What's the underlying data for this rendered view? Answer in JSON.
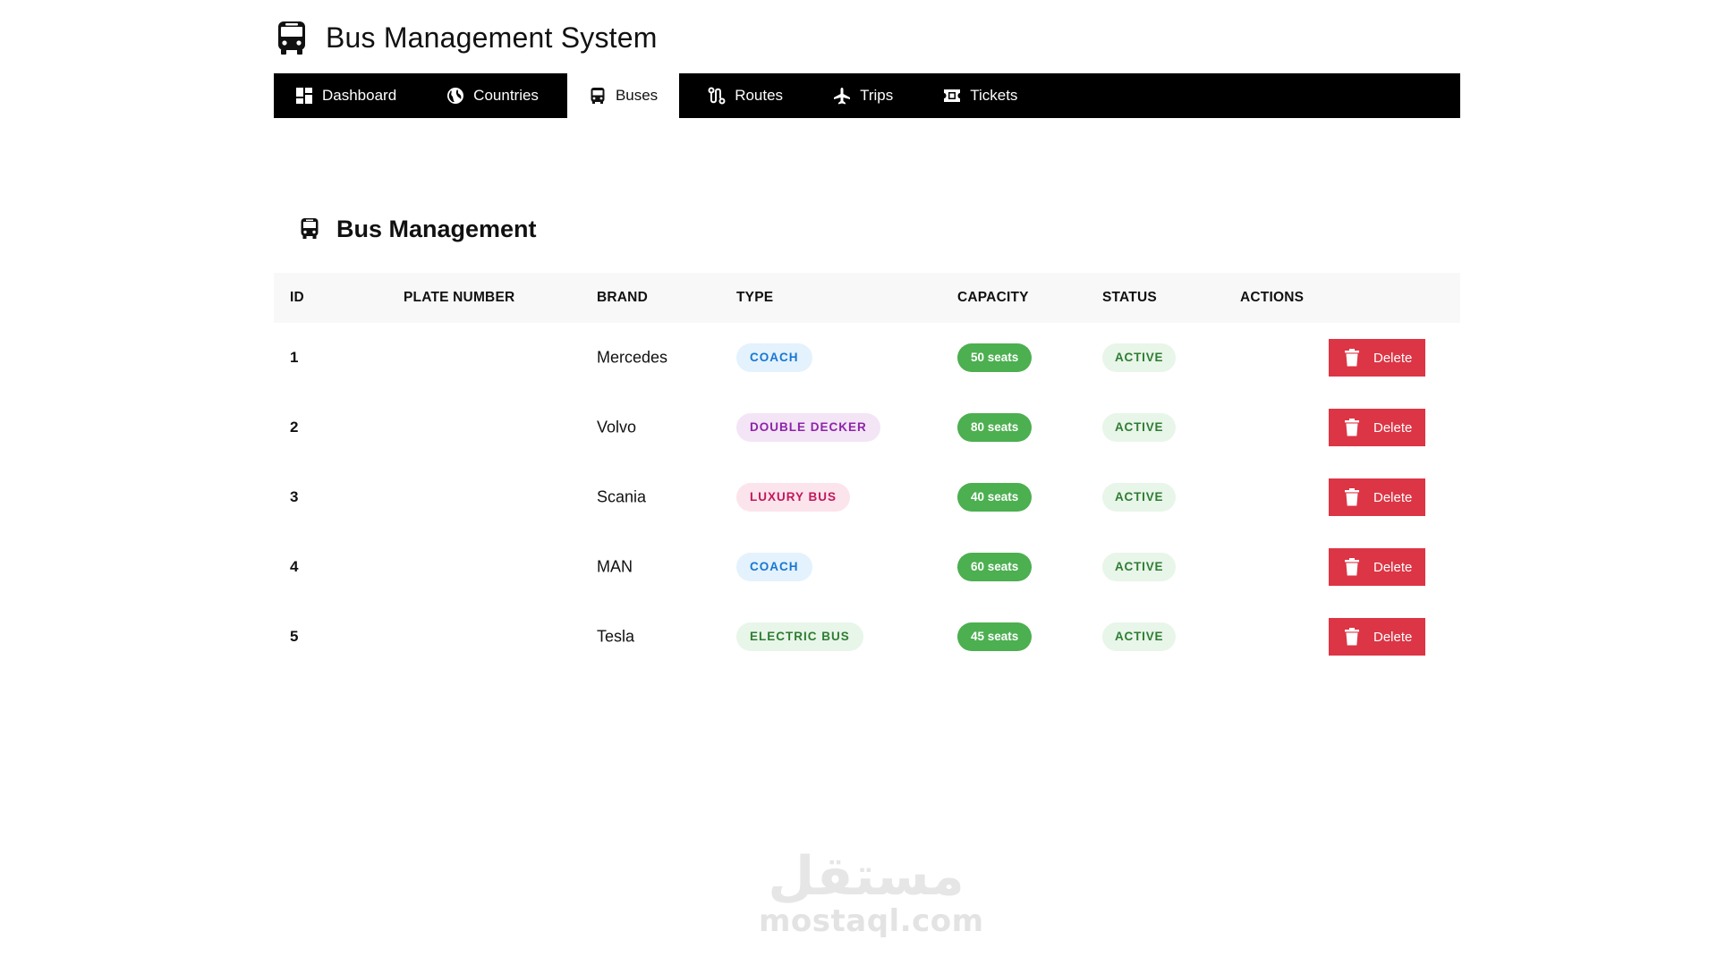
{
  "app": {
    "title": "Bus Management System",
    "logo_icon": "bus-icon"
  },
  "nav": {
    "tabs": [
      {
        "label": "Dashboard",
        "icon": "dashboard-icon",
        "active": false
      },
      {
        "label": "Countries",
        "icon": "globe-icon",
        "active": false
      },
      {
        "label": "Buses",
        "icon": "bus-icon",
        "active": true
      },
      {
        "label": "Routes",
        "icon": "route-icon",
        "active": false
      },
      {
        "label": "Trips",
        "icon": "plane-icon",
        "active": false
      },
      {
        "label": "Tickets",
        "icon": "ticket-icon",
        "active": false
      }
    ]
  },
  "section": {
    "title": "Bus Management",
    "icon": "bus-icon"
  },
  "table": {
    "headers": [
      "ID",
      "PLATE NUMBER",
      "BRAND",
      "TYPE",
      "CAPACITY",
      "STATUS",
      "ACTIONS"
    ],
    "delete_label": "Delete",
    "rows": [
      {
        "id": "1",
        "plate": "",
        "brand": "Mercedes",
        "type": "COACH",
        "type_style": "coach",
        "capacity": "50 seats",
        "status": "ACTIVE"
      },
      {
        "id": "2",
        "plate": "",
        "brand": "Volvo",
        "type": "DOUBLE DECKER",
        "type_style": "double",
        "capacity": "80 seats",
        "status": "ACTIVE"
      },
      {
        "id": "3",
        "plate": "",
        "brand": "Scania",
        "type": "LUXURY BUS",
        "type_style": "luxury",
        "capacity": "40 seats",
        "status": "ACTIVE"
      },
      {
        "id": "4",
        "plate": "",
        "brand": "MAN",
        "type": "COACH",
        "type_style": "coach",
        "capacity": "60 seats",
        "status": "ACTIVE"
      },
      {
        "id": "5",
        "plate": "",
        "brand": "Tesla",
        "type": "ELECTRIC BUS",
        "type_style": "electric",
        "capacity": "45 seats",
        "status": "ACTIVE"
      }
    ]
  },
  "colors": {
    "nav_bg": "#000000",
    "delete": "#dc3545",
    "capacity": "#4caf50",
    "status_bg": "#e8f5e9",
    "status_fg": "#2e7d32",
    "type_coach_bg": "#e3f2fd",
    "type_coach_fg": "#1976d2",
    "type_double_bg": "#f3e5f5",
    "type_double_fg": "#8e24aa",
    "type_luxury_bg": "#fce4ec",
    "type_luxury_fg": "#c2185b",
    "type_electric_bg": "#e8f5e9",
    "type_electric_fg": "#2e7d32"
  },
  "watermark": {
    "arabic": "مستقل",
    "latin": "mostaql.com"
  }
}
